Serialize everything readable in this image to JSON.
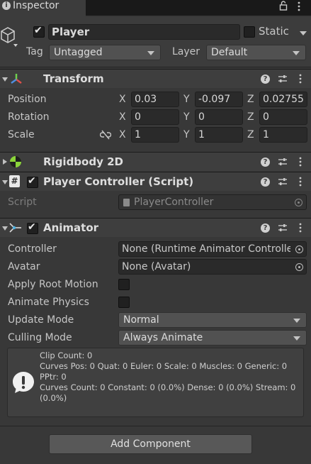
{
  "window": {
    "tab_label": "Inspector"
  },
  "gameobject": {
    "name": "Player",
    "static_label": "Static",
    "tag_label": "Tag",
    "tag_value": "Untagged",
    "layer_label": "Layer",
    "layer_value": "Default"
  },
  "transform": {
    "title": "Transform",
    "position": {
      "label": "Position",
      "x": "0.03",
      "y": "-0.097",
      "z": "0.02755"
    },
    "rotation": {
      "label": "Rotation",
      "x": "0",
      "y": "0",
      "z": "0"
    },
    "scale": {
      "label": "Scale",
      "x": "1",
      "y": "1",
      "z": "1"
    },
    "axis_x": "X",
    "axis_y": "Y",
    "axis_z": "Z"
  },
  "rigidbody": {
    "title": "Rigidbody 2D"
  },
  "player_controller": {
    "title": "Player Controller (Script)",
    "script_label": "Script",
    "script_value": "PlayerController"
  },
  "animator": {
    "title": "Animator",
    "controller_label": "Controller",
    "controller_value": "None (Runtime Animator Controlle",
    "avatar_label": "Avatar",
    "avatar_value": "None (Avatar)",
    "apply_root_motion_label": "Apply Root Motion",
    "animate_physics_label": "Animate Physics",
    "update_mode_label": "Update Mode",
    "update_mode_value": "Normal",
    "culling_mode_label": "Culling Mode",
    "culling_mode_value": "Always Animate",
    "info_lines": [
      "Clip Count: 0",
      "Curves Pos: 0 Quat: 0 Euler: 0 Scale: 0 Muscles: 0 Generic: 0",
      "PPtr: 0",
      "Curves Count: 0 Constant: 0 (0.0%) Dense: 0 (0.0%) Stream: 0",
      "(0.0%)"
    ]
  },
  "add_component_label": "Add Component",
  "colors": {
    "background": "#383838",
    "header": "#3e3e3e",
    "field": "#2a2a2a",
    "dropdown": "#515151",
    "transform_red": "#e0504a",
    "transform_green": "#6fcf4f",
    "transform_blue": "#4f8fe0",
    "rigidbody_green": "#8bd43a"
  }
}
